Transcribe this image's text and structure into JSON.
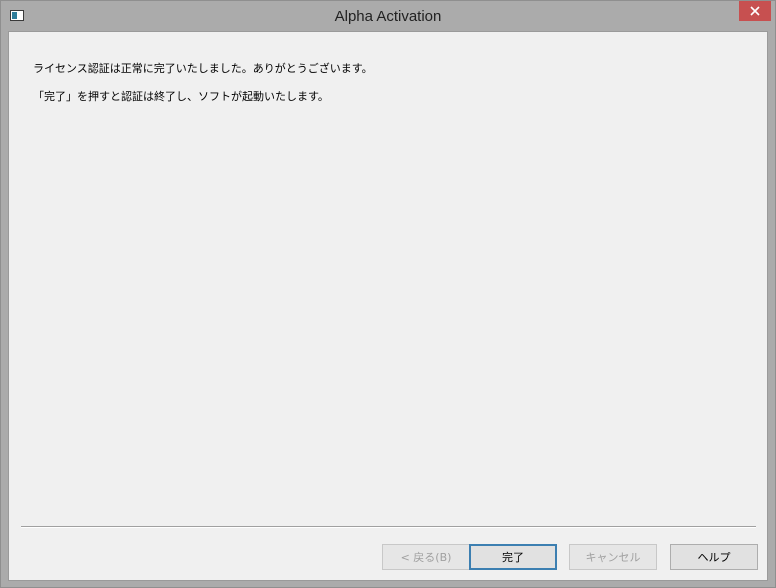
{
  "window": {
    "title": "Alpha Activation",
    "close_glyph": "✕"
  },
  "content": {
    "line1": "ライセンス認証は正常に完了いたしました。ありがとうございます。",
    "line2": "「完了」を押すと認証は終了し、ソフトが起動いたします。"
  },
  "buttons": {
    "back": "< 戻る(B)",
    "finish": "完了",
    "cancel": "キャンセル",
    "help": "ヘルプ"
  },
  "colors": {
    "close_button": "#c75050",
    "default_button_border": "#3c7fb1"
  }
}
